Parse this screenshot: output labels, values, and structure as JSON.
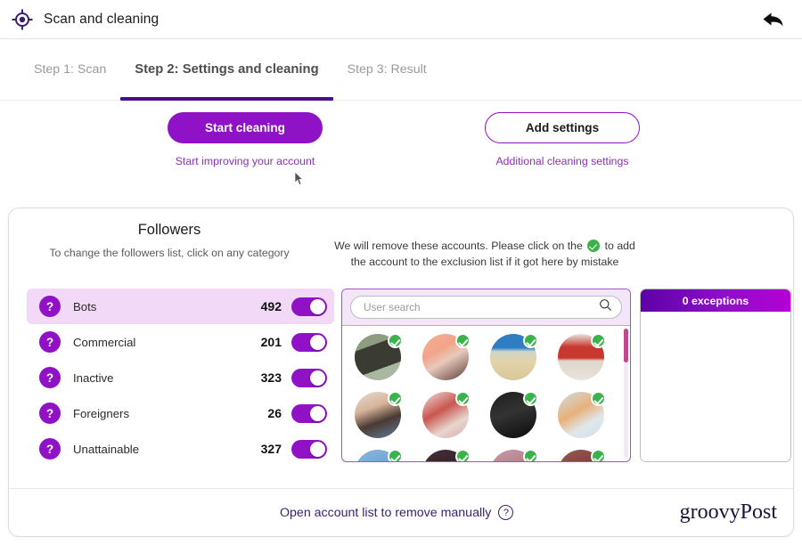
{
  "window": {
    "title": "Scan and cleaning",
    "app_icon": "target-icon",
    "back_icon": "back-arrow-icon"
  },
  "steps": [
    {
      "label": "Step 1: Scan",
      "active": false
    },
    {
      "label": "Step 2: Settings and cleaning",
      "active": true
    },
    {
      "label": "Step 3: Result",
      "active": false
    }
  ],
  "actions": {
    "primary": {
      "label": "Start cleaning",
      "caption": "Start improving your account"
    },
    "secondary": {
      "label": "Add settings",
      "caption": "Additional cleaning settings"
    }
  },
  "followers": {
    "title": "Followers",
    "subtitle": "To change the followers list, click on any category",
    "notice_part1": "We will remove these accounts. Please click on the",
    "notice_part2": "to add",
    "notice_line2": "the account to the exclusion list if it got here by mistake",
    "categories": [
      {
        "label": "Bots",
        "count": "492",
        "toggle": "on",
        "selected": true
      },
      {
        "label": "Commercial",
        "count": "201",
        "toggle": "on",
        "selected": false
      },
      {
        "label": "Inactive",
        "count": "323",
        "toggle": "on",
        "selected": false
      },
      {
        "label": "Foreigners",
        "count": "26",
        "toggle": "on",
        "selected": false
      },
      {
        "label": "Unattainable",
        "count": "327",
        "toggle": "on",
        "selected": false
      }
    ]
  },
  "account_list": {
    "search_placeholder": "User search",
    "search_value": "",
    "search_icon": "search-icon",
    "avatars": [
      {
        "c1": "#7b8a6f",
        "c2": "#3a3b33",
        "c3": "#a9b8a0",
        "badge": "checked"
      },
      {
        "c1": "#f2a48a",
        "c2": "#e8c9bd",
        "c3": "#5a3a33",
        "badge": "checked"
      },
      {
        "c1": "#2f7ec4",
        "c2": "#e3d3a8",
        "c3": "#d8c79a",
        "badge": "checked"
      },
      {
        "c1": "#e8e4dd",
        "c2": "#c9382f",
        "c3": "#ddd6ca",
        "badge": "checked"
      },
      {
        "c1": "#4a3b33",
        "c2": "#d8b39a",
        "c3": "#5f7d9c",
        "badge": "checked"
      },
      {
        "c1": "#f0e2dd",
        "c2": "#c8564f",
        "c3": "#e8d6d0",
        "badge": "checked"
      },
      {
        "c1": "#141414",
        "c2": "#2a2a2a",
        "c3": "#0a0a0a",
        "badge": "checked"
      },
      {
        "c1": "#cfe0ea",
        "c2": "#e8b07a",
        "c3": "#dfe7ec",
        "badge": "checked"
      },
      {
        "c1": "#6fa2cf",
        "c2": "#4a7ca8",
        "c3": "#8ab6dd",
        "badge": "checked"
      },
      {
        "c1": "#2b1f26",
        "c2": "#4a2e3a",
        "c3": "#1a1216",
        "badge": "checked"
      },
      {
        "c1": "#b07b8a",
        "c2": "#8a5f6d",
        "c3": "#c99aa6",
        "badge": "checked"
      },
      {
        "c1": "#7a3a3a",
        "c2": "#5a2b2b",
        "c3": "#9a5a52",
        "badge": "checked"
      }
    ],
    "scrollbar": {
      "position": "top"
    }
  },
  "exceptions": {
    "title": "0 exceptions",
    "items": []
  },
  "footer": {
    "manual_link": "Open account list to remove manually",
    "help_icon": "question-mark-icon",
    "brand": "groovyPost"
  }
}
